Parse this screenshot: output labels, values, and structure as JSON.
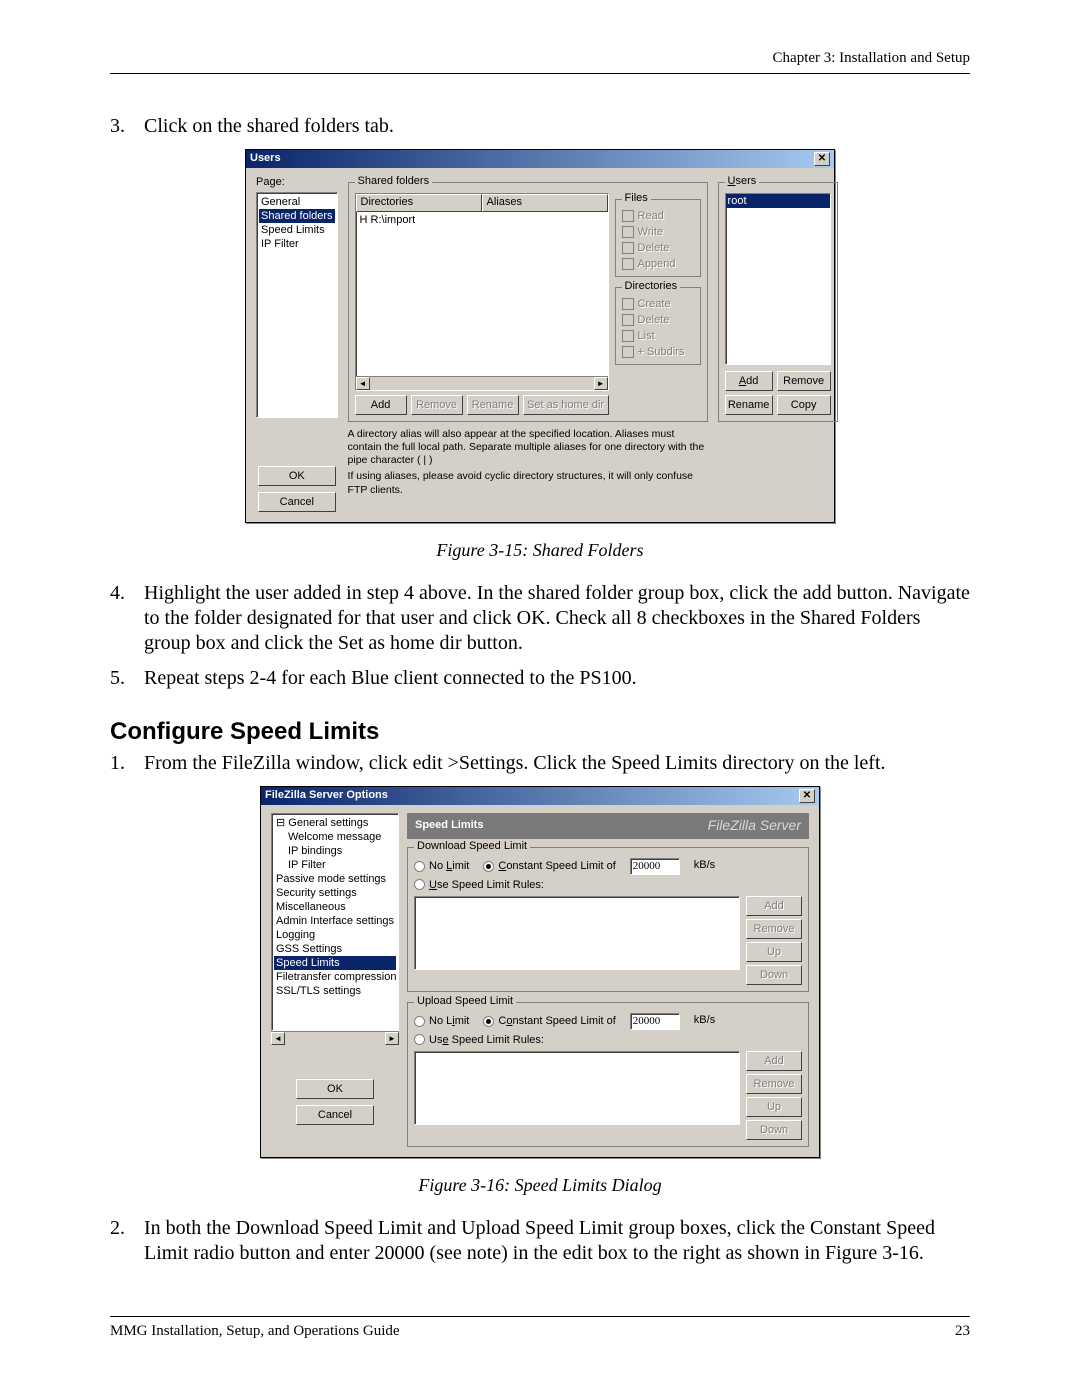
{
  "header": {
    "chapter": "Chapter 3: Installation and Setup"
  },
  "steps_top": {
    "s3_num": "3.",
    "s3_txt": "Click on the shared folders tab."
  },
  "fig15": {
    "title": "Users",
    "page_label": "Page:",
    "tree": [
      "General",
      "Shared folders",
      "Speed Limits",
      "IP Filter"
    ],
    "ok": "OK",
    "cancel": "Cancel",
    "shared_group": "Shared folders",
    "col_dir": "Directories",
    "col_alias": "Aliases",
    "row1": "H  R:\\import",
    "btn_add": "Add",
    "btn_remove": "Remove",
    "btn_rename": "Rename",
    "btn_home": "Set as home dir",
    "files_group": "Files",
    "f_read": "Read",
    "f_write": "Write",
    "f_delete": "Delete",
    "f_append": "Append",
    "dirs_group": "Directories",
    "d_create": "Create",
    "d_delete": "Delete",
    "d_list": "List",
    "d_subdirs": "+ Subdirs",
    "users_group": "Users",
    "user_root": "root",
    "u_add": "Add",
    "u_remove": "Remove",
    "u_rename": "Rename",
    "u_copy": "Copy",
    "hint1": "A directory alias will also appear at the specified location. Aliases must contain the full local path. Separate multiple aliases for one directory with the pipe character ( | )",
    "hint2": "If using aliases, please avoid cyclic directory structures, it will only confuse FTP clients.",
    "caption": "Figure 3-15: Shared Folders"
  },
  "steps_mid": {
    "s4_num": "4.",
    "s4_txt": "Highlight the user added in step 4 above. In the shared folder group box, click the add button. Navigate to the folder designated for that user and click OK. Check all 8 checkboxes in the Shared Folders group box and click the Set as home dir button.",
    "s5_num": "5.",
    "s5_txt": "Repeat steps 2-4 for each Blue client connected to the PS100."
  },
  "section_heading": "Configure Speed Limits",
  "steps_sl": {
    "s1_num": "1.",
    "s1_txt": "From the FileZilla window, click edit >Settings. Click the Speed Limits directory on the left."
  },
  "fig16": {
    "title": "FileZilla Server Options",
    "tree": [
      "General settings",
      "Welcome message",
      "IP bindings",
      "IP Filter",
      "Passive mode settings",
      "Security settings",
      "Miscellaneous",
      "Admin Interface settings",
      "Logging",
      "GSS Settings",
      "Speed Limits",
      "Filetransfer compression",
      "SSL/TLS settings"
    ],
    "ok": "OK",
    "cancel": "Cancel",
    "banner_title": "Speed Limits",
    "banner_brand": "FileZilla Server",
    "dl_group": "Download Speed Limit",
    "ul_group": "Upload Speed Limit",
    "no_limit": "No Limit",
    "constant": "Constant Speed Limit of",
    "kbs": "kB/s",
    "rules": "Use Speed Limit Rules:",
    "val": "20000",
    "btn_add": "Add",
    "btn_remove": "Remove",
    "btn_up": "Up",
    "btn_down": "Down",
    "caption": "Figure 3-16: Speed Limits Dialog"
  },
  "steps_after16": {
    "s2_num": "2.",
    "s2_txt": "In both the Download Speed Limit and Upload Speed Limit group boxes, click the Constant Speed Limit radio button and enter 20000 (see note) in the edit box to the right as shown in Figure 3-16."
  },
  "footer": {
    "left": "MMG Installation, Setup, and Operations Guide",
    "right": "23"
  }
}
